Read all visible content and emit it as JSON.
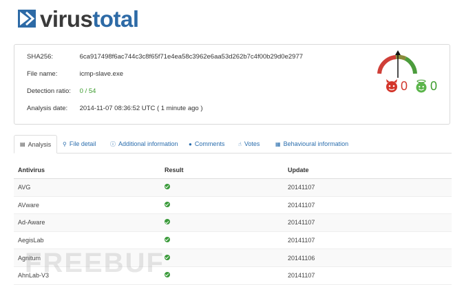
{
  "header": {
    "logo_part1": "virus",
    "logo_part2": "total"
  },
  "summary": {
    "sha256_label": "SHA256:",
    "sha256_value": "6ca917498f6ac744c3c8f65f71e4ea58c3962e6aa53d262b7c4f00b29d0e2977",
    "filename_label": "File name:",
    "filename_value": "icmp-slave.exe",
    "ratio_label": "Detection ratio:",
    "ratio_value": "0 / 54",
    "date_label": "Analysis date:",
    "date_value": "2014-11-07 08:36:52 UTC ( 1 minute ago )",
    "votes_bad": "0",
    "votes_good": "0",
    "colors": {
      "bad": "#d0352c",
      "good": "#3c9c2c",
      "link": "#2a6dad"
    }
  },
  "tabs": [
    {
      "label": "Analysis",
      "icon": "table-icon"
    },
    {
      "label": "File detail",
      "icon": "magnifier-icon"
    },
    {
      "label": "Additional information",
      "icon": "info-icon"
    },
    {
      "label": "Comments",
      "icon": "comment-icon"
    },
    {
      "label": "Votes",
      "icon": "thumbs-icon"
    },
    {
      "label": "Behavioural information",
      "icon": "film-icon"
    }
  ],
  "table": {
    "headers": {
      "antivirus": "Antivirus",
      "result": "Result",
      "update": "Update"
    },
    "rows": [
      {
        "antivirus": "AVG",
        "update": "20141107"
      },
      {
        "antivirus": "AVware",
        "update": "20141107"
      },
      {
        "antivirus": "Ad-Aware",
        "update": "20141107"
      },
      {
        "antivirus": "AegisLab",
        "update": "20141107"
      },
      {
        "antivirus": "Agnitum",
        "update": "20141106"
      },
      {
        "antivirus": "AhnLab-V3",
        "update": "20141107"
      }
    ]
  },
  "watermark": "FREEBUF"
}
